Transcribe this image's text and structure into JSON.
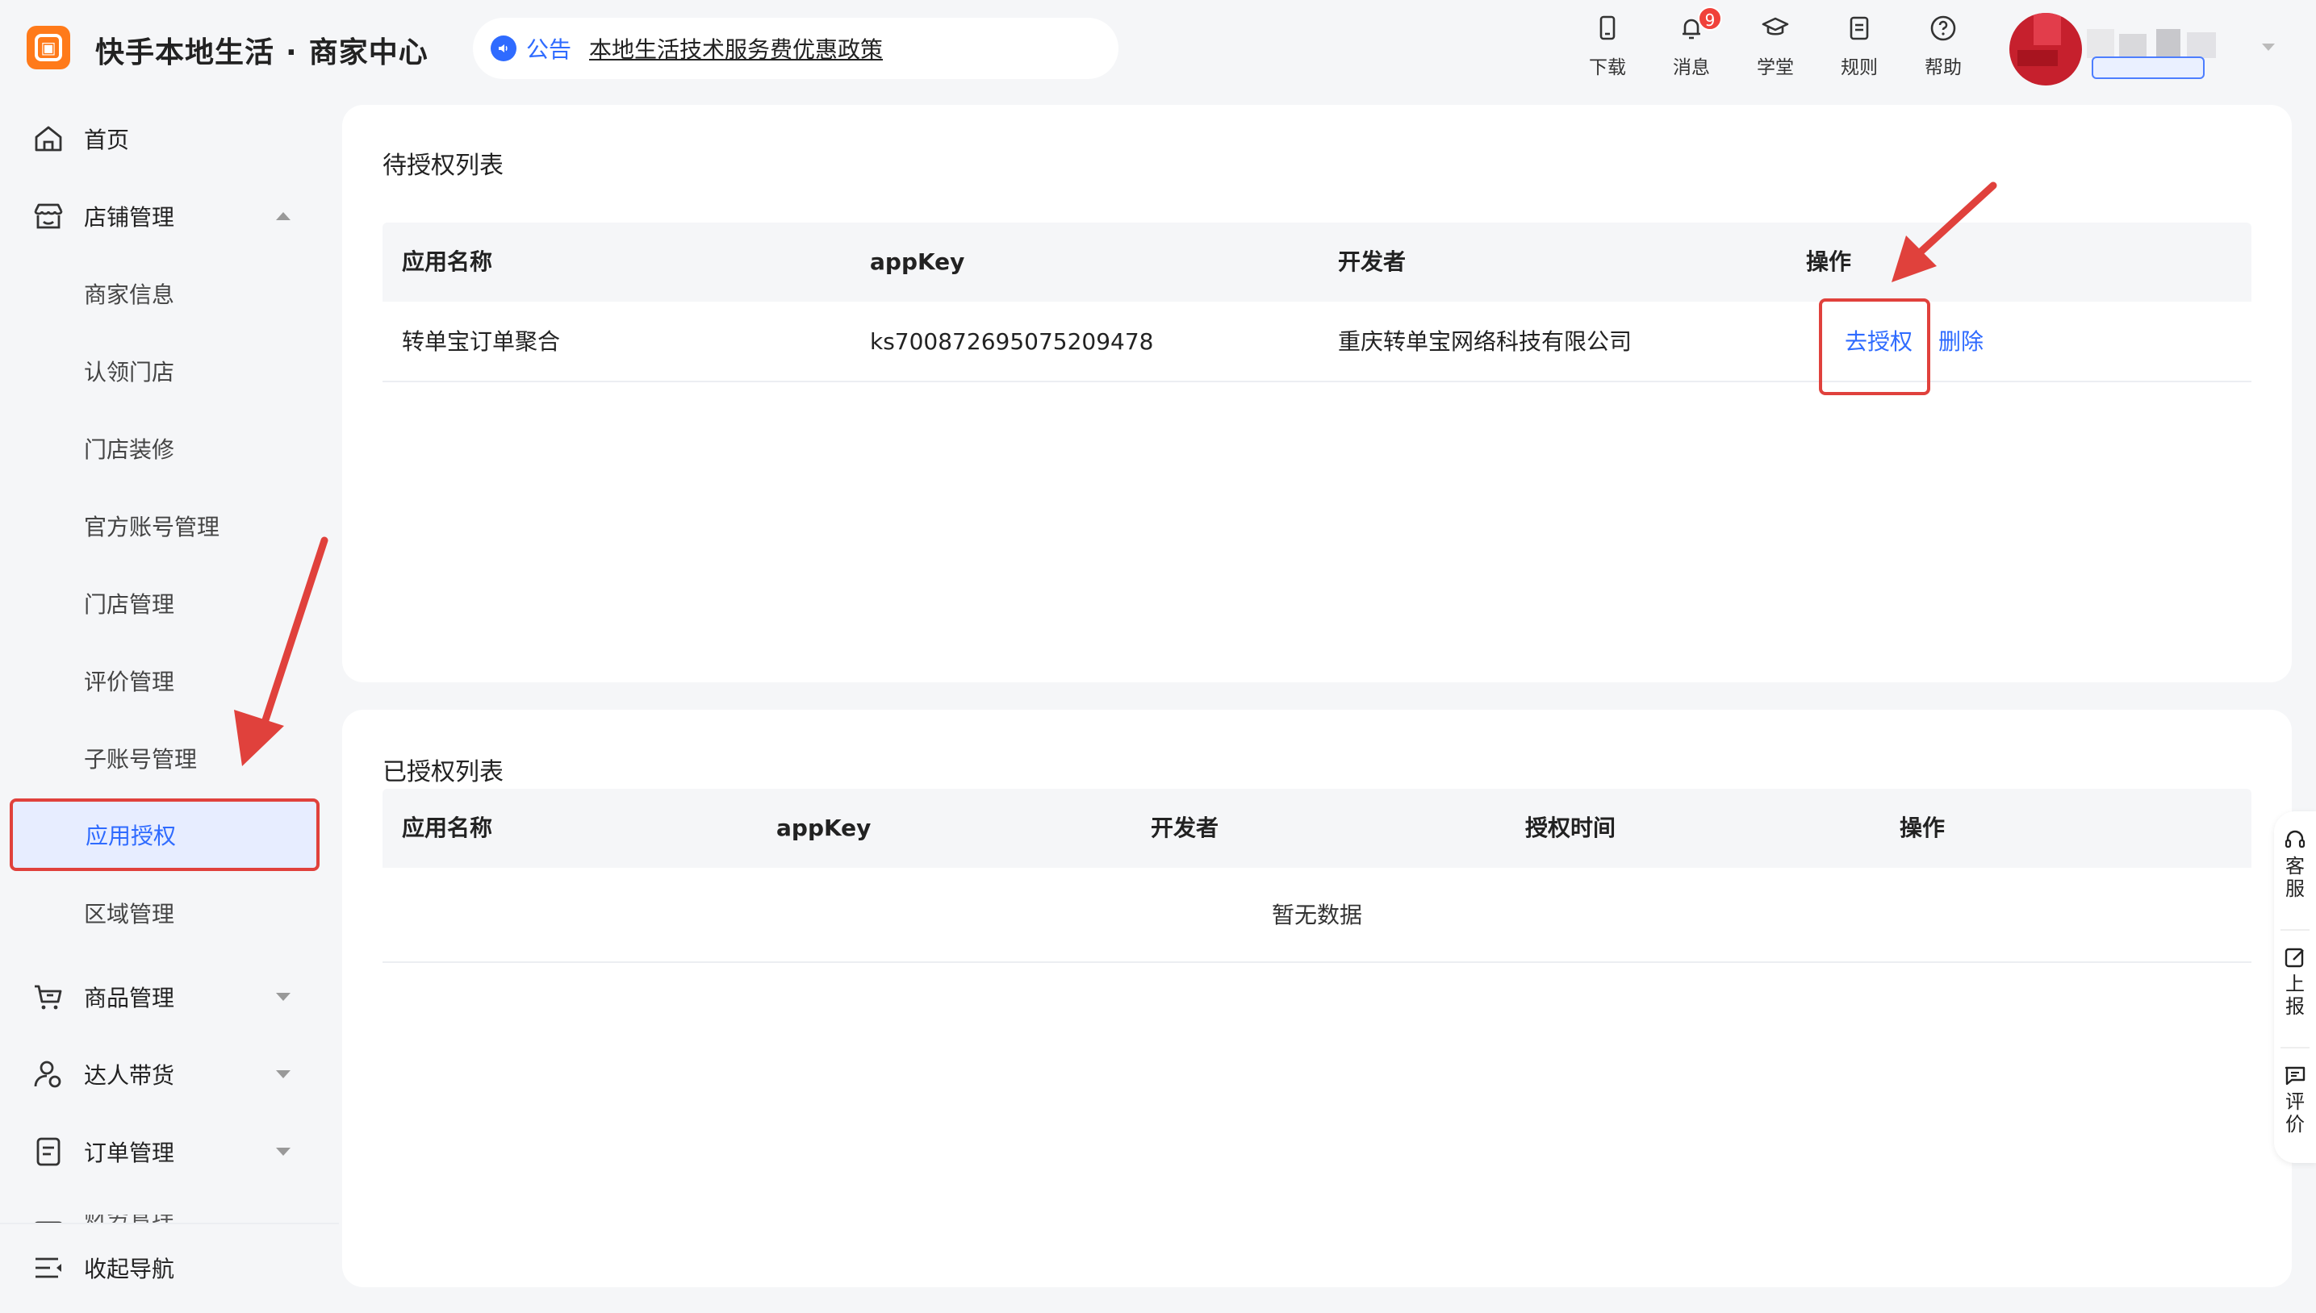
{
  "header": {
    "brand_name": "快手本地生活",
    "brand_dot": "·",
    "brand_sub": "商家中心",
    "notice_label": "公告",
    "notice_text": "本地生活技术服务费优惠政策",
    "tools": [
      {
        "label": "下载",
        "icon": "phone-icon"
      },
      {
        "label": "消息",
        "icon": "bell-icon",
        "badge": "9"
      },
      {
        "label": "学堂",
        "icon": "graduation-cap-icon"
      },
      {
        "label": "规则",
        "icon": "document-icon"
      },
      {
        "label": "帮助",
        "icon": "help-icon"
      }
    ]
  },
  "sidebar": {
    "items": [
      {
        "label": "首页",
        "icon": "home-icon"
      },
      {
        "label": "店铺管理",
        "icon": "store-icon",
        "expanded": true
      },
      {
        "label": "商家信息"
      },
      {
        "label": "认领门店"
      },
      {
        "label": "门店装修"
      },
      {
        "label": "官方账号管理"
      },
      {
        "label": "门店管理"
      },
      {
        "label": "评价管理"
      },
      {
        "label": "子账号管理"
      },
      {
        "label": "应用授权",
        "active": true
      },
      {
        "label": "区域管理"
      },
      {
        "label": "商品管理",
        "icon": "cart-icon",
        "expanded": false
      },
      {
        "label": "达人带货",
        "icon": "user-icon",
        "expanded": false
      },
      {
        "label": "订单管理",
        "icon": "order-icon",
        "expanded": false
      },
      {
        "label": "财务管理",
        "icon": "wallet-icon"
      }
    ],
    "collapse_label": "收起导航"
  },
  "pending": {
    "title": "待授权列表",
    "columns": [
      "应用名称",
      "appKey",
      "开发者",
      "操作"
    ],
    "rows": [
      {
        "app_name": "转单宝订单聚合",
        "app_key": "ks700872695075209478",
        "developer": "重庆转单宝网络科技有限公司",
        "action_authorize": "去授权",
        "action_delete": "删除"
      }
    ]
  },
  "authorized": {
    "title": "已授权列表",
    "columns": [
      "应用名称",
      "appKey",
      "开发者",
      "授权时间",
      "操作"
    ],
    "empty_text": "暂无数据"
  },
  "float": {
    "items": [
      {
        "label": "客服",
        "icon": "headset-icon"
      },
      {
        "label": "上报",
        "icon": "edit-icon"
      },
      {
        "label": "评价",
        "icon": "comment-icon"
      }
    ]
  },
  "colors": {
    "accent": "#2f6bff",
    "highlight": "#e0413c",
    "brand": "#ff7a1a"
  }
}
